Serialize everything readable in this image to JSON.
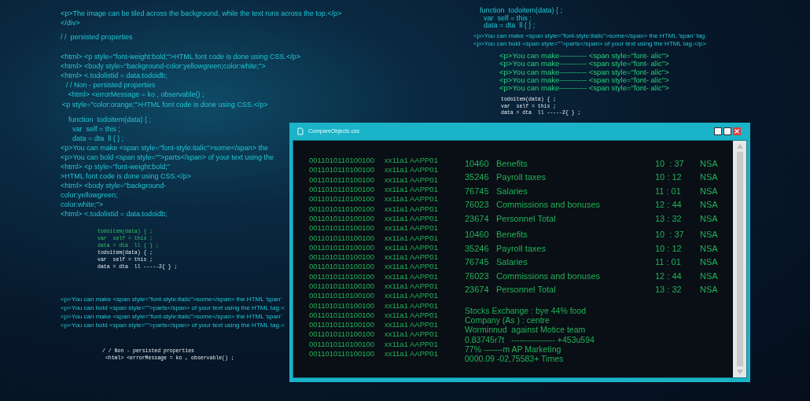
{
  "background_code": [
    {
      "kind": "sans",
      "lines": [
        "<p>The image can be tiled across the background, while the text runs across the top.</p>",
        "</div>"
      ]
    },
    {
      "kind": "sans",
      "lines": [
        "/ /  persisted properties"
      ]
    },
    {
      "kind": "sans",
      "lines": [
        "<html> <p style=\"font-weight:bold;\">HTML font code is done using CSS.</p>",
        "<html> <body style=\"background-color:yellowgreen;color:white;\">",
        "<html> <.todolistid = data.todoidb;"
      ]
    },
    {
      "kind": "sans",
      "lines": [
        "/ / Non - persisted properties",
        " <html> <errorMessage = ko , observable() ;"
      ]
    },
    {
      "kind": "sans",
      "lines": [
        "<p style=\"color:orange;\">HTML font code is done using CSS.</p>"
      ]
    },
    {
      "kind": "sans",
      "lines": [
        "    function  todoitem(data) { ;",
        "      var  self = this ;",
        "      data = dta  ll { } ;",
        "<p>You can make <span style=\"font-style:italic\">some</span> the",
        "<p>You can bold <span style=\"\">parts</span> of your text using the"
      ]
    },
    {
      "kind": "sans",
      "lines": [
        "<html> <p style=\"font-weight:bold;\"",
        ">HTML font code is done using CSS.</p>",
        "<html> <body style=\"background-",
        "color:yellowgreen;",
        "color:white;\">",
        "<html> <.todolistid = data.todoidb;"
      ]
    },
    {
      "kind": "mono_green",
      "lines": [
        "todoitem(data) { ;",
        "var  self = this ;",
        "data = dta  ll { } ;"
      ]
    },
    {
      "kind": "mono",
      "lines": [
        "todoitem(data) { ;",
        "var  self = this ;",
        "data = dta  ll -----2{ } ;"
      ]
    },
    {
      "kind": "sans_small",
      "lines": [
        "<p>You can make <span style=\"font-style:italic\">some</span> the HTML 'span'",
        "<p>You can bold <span style=\"\">parts</span> of your text using the HTML tag.<",
        "<p>You can make <span style=\"font-style:italic\">some</span> the HTML 'span'",
        "<p>You can bold <span style=\"\">parts</span> of your text using the HTML tag.<"
      ]
    },
    {
      "kind": "mono",
      "lines": [
        "/ / Non - persisted properties",
        " <html> <errorMessage = ko , observable() ;"
      ]
    },
    {
      "kind": "sans",
      "lines": [
        "function  todoitem(data) { ;",
        "  var  self = this ;",
        "  data = dta  ll { } ;"
      ]
    },
    {
      "kind": "sans_small",
      "lines": [
        "<p>You can make <span style=\"font-style:italic\">some</span> the HTML 'span' tag.",
        "<p>You can bold <span style=\"\">parts</span> of your text using the HTML tag.</p>"
      ]
    },
    {
      "kind": "green",
      "lines": [
        "<p>You can make----------- <span style=\"font- alic\">",
        "<p>You can make----------- <span style=\"font- alic\">",
        "<p>You can make----------- <span style=\"font- alic\">",
        "<p>You can make----------- <span style=\"font- alic\">",
        "<p>You can make----------- <span style=\"font- alic\">"
      ]
    },
    {
      "kind": "mono",
      "lines": [
        "todoitem(data) { ;",
        "var  self = this ;",
        "data = dta  ll -----2{ } ;"
      ]
    }
  ],
  "window": {
    "title": "CompareObjects.css",
    "binary_rows": [
      {
        "bits": "0011010110100100",
        "code": "xx11a1",
        "id": "AAPP01"
      },
      {
        "bits": "0011010110100100",
        "code": "xx11a1",
        "id": "AAPP01"
      },
      {
        "bits": "0011010110100100",
        "code": "xx11a1",
        "id": "AAPP01"
      },
      {
        "bits": "0011010110100100",
        "code": "xx11a1",
        "id": "AAPP01"
      },
      {
        "bits": "0011010110100100",
        "code": "xx11a1",
        "id": "AAPP01"
      },
      {
        "bits": "0011010110100100",
        "code": "xx11a1",
        "id": "AAPP01"
      },
      {
        "bits": "0011010110100100",
        "code": "xx11a1",
        "id": "AAPP01"
      },
      {
        "bits": "0011010110100100",
        "code": "xx11a1",
        "id": "AAPP01"
      },
      {
        "bits": "0011010110100100",
        "code": "xx11a1",
        "id": "AAPP01"
      },
      {
        "bits": "0011010110100100",
        "code": "xx11a1",
        "id": "AAPP01"
      },
      {
        "bits": "0011010110100100",
        "code": "xx11a1",
        "id": "AAPP01"
      },
      {
        "bits": "0011010110100100",
        "code": "xx11a1",
        "id": "AAPP01"
      },
      {
        "bits": "0011010110100100",
        "code": "xx11a1",
        "id": "AAPP01"
      },
      {
        "bits": "0011010110100100",
        "code": "xx11a1",
        "id": "AAPP01"
      },
      {
        "bits": "0011010110100100",
        "code": "xx11a1",
        "id": "AAPP01"
      },
      {
        "bits": "0011010110100100",
        "code": "xx11a1",
        "id": "AAPP01"
      },
      {
        "bits": "0011010110100100",
        "code": "xx11a1",
        "id": "AAPP01"
      },
      {
        "bits": "0011010110100100",
        "code": "xx11a1",
        "id": "AAPP01"
      },
      {
        "bits": "0011010110100100",
        "code": "xx11a1",
        "id": "AAPP01"
      },
      {
        "bits": "0011010110100100",
        "code": "xx11a1",
        "id": "AAPP01"
      },
      {
        "bits": "0011010110100100",
        "code": "xx11a1",
        "id": "AAPP01"
      }
    ],
    "ledger_groups": [
      {
        "rows": [
          {
            "number": "10460",
            "name": "Benefits",
            "time": "10  : 37",
            "status": "NSA"
          },
          {
            "number": "35246",
            "name": "Payroll taxes",
            "time": "10 : 12",
            "status": "NSA"
          },
          {
            "number": "76745",
            "name": "Salaries",
            "time": "11 : 01",
            "status": "NSA"
          },
          {
            "number": "76023",
            "name": "Commissions and bonuses",
            "time": "12 : 44",
            "status": "NSA"
          },
          {
            "number": "23674",
            "name": "Personnel Total",
            "time": "13 : 32",
            "status": "NSA"
          }
        ]
      },
      {
        "rows": [
          {
            "number": "10460",
            "name": "Benefits",
            "time": "10  : 37",
            "status": "NSA"
          },
          {
            "number": "35246",
            "name": "Payroll taxes",
            "time": "10 : 12",
            "status": "NSA"
          },
          {
            "number": "76745",
            "name": "Salaries",
            "time": "11 : 01",
            "status": "NSA"
          },
          {
            "number": "76023",
            "name": "Commissions and bonuses",
            "time": "12 : 44",
            "status": "NSA"
          },
          {
            "number": "23674",
            "name": "Personnel Total",
            "time": "13 : 32",
            "status": "NSA"
          }
        ]
      }
    ],
    "notes": [
      "Stocks Exchange : bye 44% food",
      "Company (As ) : centre",
      "Worminnud  against Motice team",
      "0.83745r7t   ---------------- +453u594",
      "77% -------m AP Marketing",
      "0000.09 -02,75583+ Times"
    ]
  }
}
